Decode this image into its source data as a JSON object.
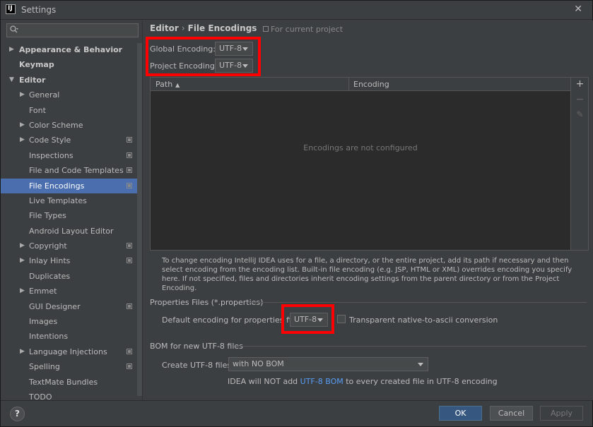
{
  "window": {
    "title": "Settings",
    "app_icon_text": "IJ",
    "close_glyph": "✕"
  },
  "sidebar": {
    "search_placeholder": "",
    "items": [
      {
        "label": "Appearance & Behavior",
        "level": 0,
        "bold": true,
        "arrow": "▶"
      },
      {
        "label": "Keymap",
        "level": 0,
        "bold": true,
        "arrow": ""
      },
      {
        "label": "Editor",
        "level": 0,
        "bold": true,
        "arrow": "▼"
      },
      {
        "label": "General",
        "level": 1,
        "arrow": "▶"
      },
      {
        "label": "Font",
        "level": 1,
        "arrow": ""
      },
      {
        "label": "Color Scheme",
        "level": 1,
        "arrow": "▶"
      },
      {
        "label": "Code Style",
        "level": 1,
        "arrow": "▶",
        "project": true
      },
      {
        "label": "Inspections",
        "level": 1,
        "arrow": "",
        "project": true
      },
      {
        "label": "File and Code Templates",
        "level": 1,
        "arrow": "",
        "project": true
      },
      {
        "label": "File Encodings",
        "level": 1,
        "arrow": "",
        "project": true,
        "selected": true
      },
      {
        "label": "Live Templates",
        "level": 1,
        "arrow": ""
      },
      {
        "label": "File Types",
        "level": 1,
        "arrow": ""
      },
      {
        "label": "Android Layout Editor",
        "level": 1,
        "arrow": ""
      },
      {
        "label": "Copyright",
        "level": 1,
        "arrow": "▶",
        "project": true
      },
      {
        "label": "Inlay Hints",
        "level": 1,
        "arrow": "▶",
        "project": true
      },
      {
        "label": "Duplicates",
        "level": 1,
        "arrow": ""
      },
      {
        "label": "Emmet",
        "level": 1,
        "arrow": "▶"
      },
      {
        "label": "GUI Designer",
        "level": 1,
        "arrow": "",
        "project": true
      },
      {
        "label": "Images",
        "level": 1,
        "arrow": ""
      },
      {
        "label": "Intentions",
        "level": 1,
        "arrow": ""
      },
      {
        "label": "Language Injections",
        "level": 1,
        "arrow": "▶",
        "project": true
      },
      {
        "label": "Spelling",
        "level": 1,
        "arrow": "",
        "project": true
      },
      {
        "label": "TextMate Bundles",
        "level": 1,
        "arrow": ""
      },
      {
        "label": "TODO",
        "level": 1,
        "arrow": ""
      }
    ]
  },
  "content": {
    "breadcrumb": {
      "part1": "Editor",
      "separator": "›",
      "part2": "File Encodings"
    },
    "for_project": "For current project",
    "global_encoding": {
      "label": "Global Encoding:",
      "value": "UTF-8"
    },
    "project_encoding": {
      "label": "Project Encoding:",
      "value": "UTF-8"
    },
    "table": {
      "col_path": "Path",
      "sort_glyph": "▲",
      "col_encoding": "Encoding",
      "empty_text": "Encodings are not configured"
    },
    "toolbar": {
      "add": "+",
      "remove": "−",
      "edit": "✎"
    },
    "help_text": "To change encoding IntelliJ IDEA uses for a file, a directory, or the entire project, add its path if necessary and then select encoding from the encoding list. Built-in file encoding (e.g. JSP, HTML or XML) overrides encoding you specify here. If not specified, files and directories inherit encoding settings from the parent directory or from the Project Encoding.",
    "properties": {
      "section_title": "Properties Files (*.properties)",
      "default_label": "Default encoding for properties files:",
      "default_value": "UTF-8",
      "native_label": "Transparent native-to-ascii conversion",
      "native_checked": false
    },
    "bom": {
      "section_title": "BOM for new UTF-8 files",
      "create_label": "Create UTF-8 files:",
      "create_value": "with NO BOM",
      "info_prefix": "IDEA will NOT add ",
      "info_link": "UTF-8 BOM",
      "info_suffix": " to every created file in UTF-8 encoding"
    }
  },
  "footer": {
    "help": "?",
    "ok": "OK",
    "cancel": "Cancel",
    "apply": "Apply"
  },
  "colors": {
    "highlight": "#ff0000",
    "selection": "#4b6eaf",
    "primary_button": "#365880",
    "link": "#589df6"
  }
}
